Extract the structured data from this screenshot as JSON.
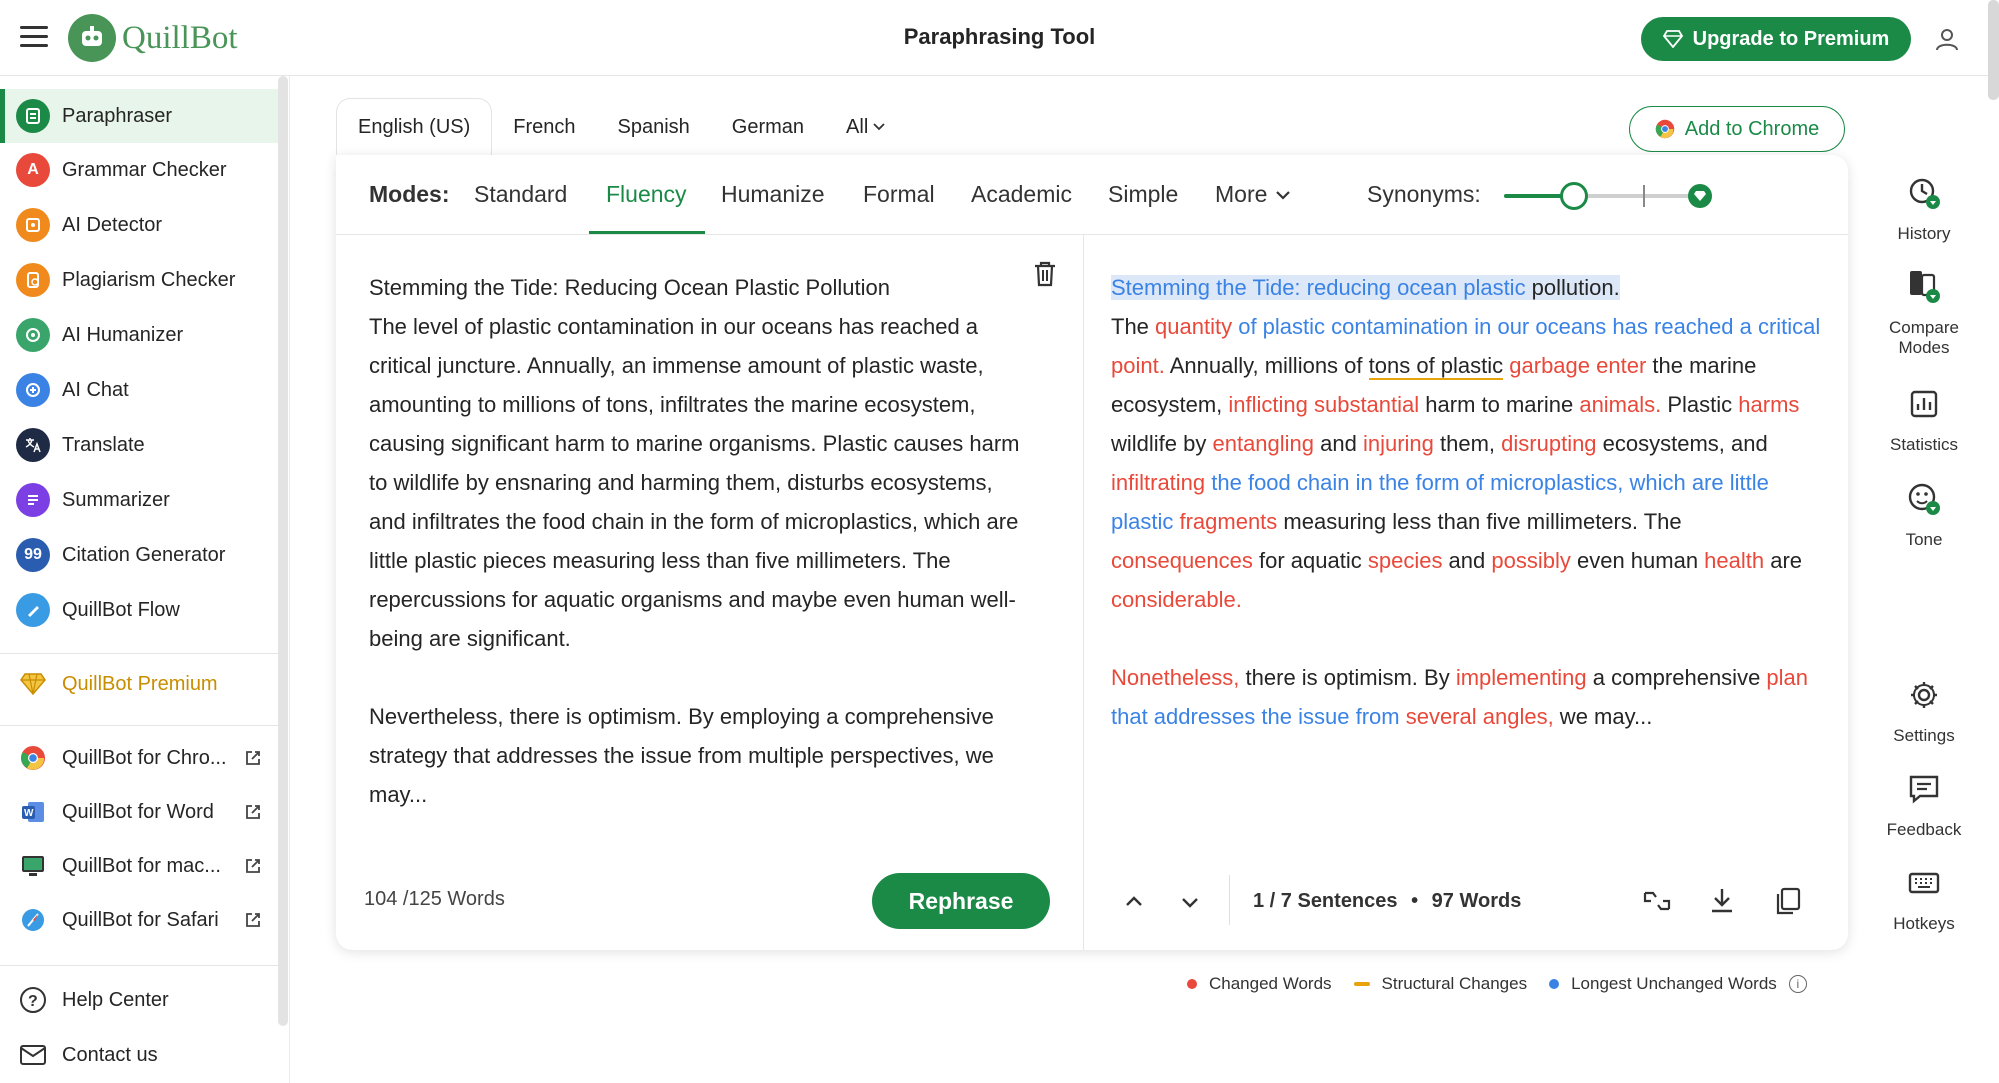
{
  "header": {
    "logo_text": "QuillBot",
    "title": "Paraphrasing Tool",
    "upgrade_label": "Upgrade to Premium"
  },
  "sidebar": {
    "items": [
      {
        "label": "Paraphraser",
        "icon": "paraphraser-icon",
        "color": "#1b8a47"
      },
      {
        "label": "Grammar Checker",
        "icon": "grammar-icon",
        "color": "#e8493a"
      },
      {
        "label": "AI Detector",
        "icon": "ai-detector-icon",
        "color": "#f08a1c"
      },
      {
        "label": "Plagiarism Checker",
        "icon": "plagiarism-icon",
        "color": "#f08a1c"
      },
      {
        "label": "AI Humanizer",
        "icon": "humanizer-icon",
        "color": "#3aa56b"
      },
      {
        "label": "AI Chat",
        "icon": "chat-icon",
        "color": "#3a83e5"
      },
      {
        "label": "Translate",
        "icon": "translate-icon",
        "color": "#1f2a44"
      },
      {
        "label": "Summarizer",
        "icon": "summarizer-icon",
        "color": "#7b3fe4"
      },
      {
        "label": "Citation Generator",
        "icon": "citation-icon",
        "color": "#2a5db0"
      },
      {
        "label": "QuillBot Flow",
        "icon": "flow-icon",
        "color": "#3a9be5"
      }
    ],
    "premium_label": "QuillBot Premium",
    "extensions": [
      {
        "label": "QuillBot for Chro...",
        "icon": "chrome-icon"
      },
      {
        "label": "QuillBot for Word",
        "icon": "word-icon"
      },
      {
        "label": "QuillBot for mac...",
        "icon": "mac-icon"
      },
      {
        "label": "QuillBot for Safari",
        "icon": "safari-icon"
      }
    ],
    "help_label": "Help Center",
    "contact_label": "Contact us"
  },
  "languages": [
    "English (US)",
    "French",
    "Spanish",
    "German",
    "All"
  ],
  "add_chrome_label": "Add to Chrome",
  "modes": {
    "label": "Modes:",
    "items": [
      "Standard",
      "Fluency",
      "Humanize",
      "Formal",
      "Academic",
      "Simple",
      "More"
    ],
    "active": "Fluency",
    "synonyms_label": "Synonyms:",
    "synonyms_level": 0.35
  },
  "input": {
    "text": "Stemming the Tide: Reducing Ocean Plastic Pollution\nThe level of plastic contamination in our oceans has reached a critical juncture. Annually, an immense amount of plastic waste, amounting to millions of tons, infiltrates the marine ecosystem, causing significant harm to marine organisms. Plastic causes harm to wildlife by ensnaring and harming them, disturbs ecosystems, and infiltrates the food chain in the form of microplastics, which are little plastic pieces measuring less than five millimeters. The repercussions for aquatic organisms and maybe even human well-being are significant.\n\nNevertheless, there is optimism. By employing a comprehensive strategy that addresses the issue from multiple perspectives, we may...",
    "word_count": "104 /125 Words",
    "rephrase_label": "Rephrase"
  },
  "output": {
    "segments": [
      {
        "t": "Stemming the Tide: reducing ocean plastic",
        "c": "unc sel"
      },
      {
        "t": " pollution.",
        "c": "sel"
      },
      {
        "t": "\nThe ",
        "c": ""
      },
      {
        "t": "quantity",
        "c": "chg"
      },
      {
        "t": " of plastic contamination in our oceans has reached a critical",
        "c": "unc"
      },
      {
        "t": " point.",
        "c": "chg"
      },
      {
        "t": " Annually, millions of ",
        "c": ""
      },
      {
        "t": "tons of plastic",
        "c": "struct"
      },
      {
        "t": " garbage enter",
        "c": "chg"
      },
      {
        "t": " the marine ecosystem, ",
        "c": ""
      },
      {
        "t": "inflicting substantial",
        "c": "chg"
      },
      {
        "t": " harm to marine ",
        "c": ""
      },
      {
        "t": "animals.",
        "c": "chg"
      },
      {
        "t": " Plastic ",
        "c": ""
      },
      {
        "t": "harms",
        "c": "chg"
      },
      {
        "t": " wildlife by ",
        "c": ""
      },
      {
        "t": "entangling",
        "c": "chg"
      },
      {
        "t": " and ",
        "c": ""
      },
      {
        "t": "injuring",
        "c": "chg"
      },
      {
        "t": " them, ",
        "c": ""
      },
      {
        "t": "disrupting",
        "c": "chg"
      },
      {
        "t": " ecosystems, and ",
        "c": ""
      },
      {
        "t": "infiltrating",
        "c": "chg"
      },
      {
        "t": " the food chain in the form of microplastics, which are little plastic",
        "c": "unc"
      },
      {
        "t": " fragments",
        "c": "chg"
      },
      {
        "t": " measuring less than five millimeters. The ",
        "c": ""
      },
      {
        "t": "consequences",
        "c": "chg"
      },
      {
        "t": " for aquatic ",
        "c": ""
      },
      {
        "t": "species",
        "c": "chg"
      },
      {
        "t": " and ",
        "c": ""
      },
      {
        "t": "possibly",
        "c": "chg"
      },
      {
        "t": " even human ",
        "c": ""
      },
      {
        "t": "health",
        "c": "chg"
      },
      {
        "t": " are ",
        "c": ""
      },
      {
        "t": "considerable.",
        "c": "chg"
      },
      {
        "t": "\n\n",
        "c": ""
      },
      {
        "t": "Nonetheless,",
        "c": "chg"
      },
      {
        "t": " there is optimism. By ",
        "c": ""
      },
      {
        "t": "implementing",
        "c": "chg"
      },
      {
        "t": " a comprehensive ",
        "c": ""
      },
      {
        "t": "plan",
        "c": "chg"
      },
      {
        "t": " that addresses the issue from",
        "c": "unc"
      },
      {
        "t": " several angles,",
        "c": "chg"
      },
      {
        "t": " we may...",
        "c": ""
      }
    ],
    "sentences": "1 / 7 Sentences",
    "bullet": "•",
    "words": "97 Words"
  },
  "legend": {
    "changed": "Changed Words",
    "structural": "Structural Changes",
    "unchanged": "Longest Unchanged Words",
    "colors": {
      "changed": "#e8493a",
      "structural": "#e8a20c",
      "unchanged": "#3a83e5"
    }
  },
  "rail": {
    "history": "History",
    "compare": "Compare Modes",
    "statistics": "Statistics",
    "tone": "Tone",
    "settings": "Settings",
    "feedback": "Feedback",
    "hotkeys": "Hotkeys"
  },
  "colors": {
    "brand": "#1b8a47",
    "premium": "#c98d00"
  }
}
